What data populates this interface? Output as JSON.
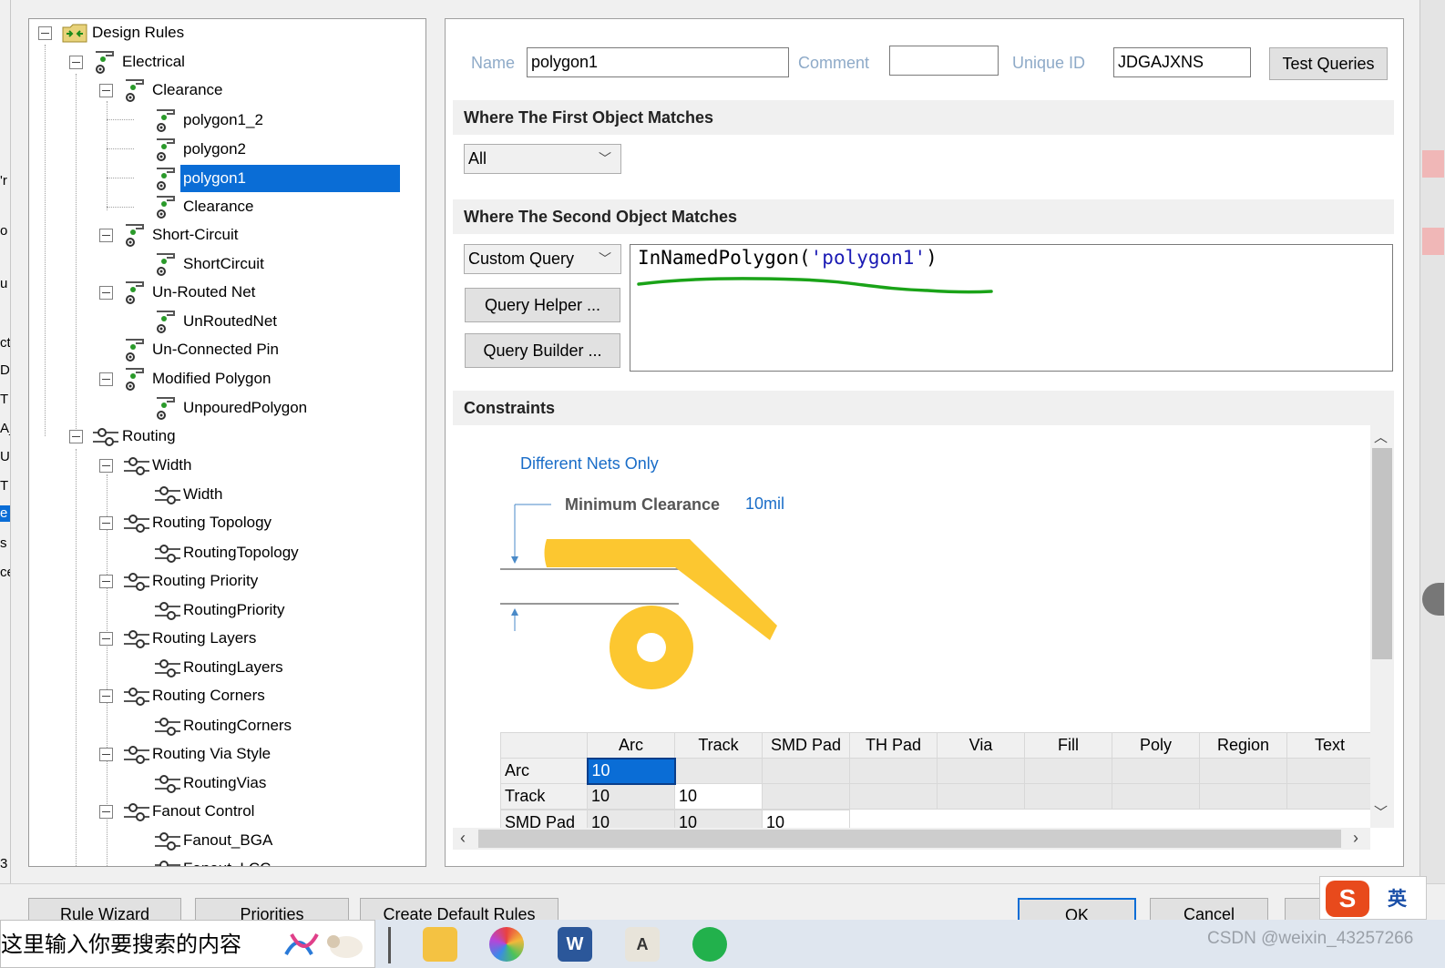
{
  "tree": {
    "root": "Design Rules",
    "electrical": "Electrical",
    "clearance": "Clearance",
    "polygon1_2": "polygon1_2",
    "polygon2": "polygon2",
    "polygon1": "polygon1",
    "clearance_rule": "Clearance",
    "short_circuit": "Short-Circuit",
    "short_circuit_rule": "ShortCircuit",
    "unrouted_net": "Un-Routed Net",
    "unrouted_net_rule": "UnRoutedNet",
    "unconnected_pin": "Un-Connected Pin",
    "modified_polygon": "Modified Polygon",
    "unpoured_polygon": "UnpouredPolygon",
    "routing": "Routing",
    "width": "Width",
    "width_rule": "Width",
    "routing_topology": "Routing Topology",
    "routing_topology_rule": "RoutingTopology",
    "routing_priority": "Routing Priority",
    "routing_priority_rule": "RoutingPriority",
    "routing_layers": "Routing Layers",
    "routing_layers_rule": "RoutingLayers",
    "routing_corners": "Routing Corners",
    "routing_corners_rule": "RoutingCorners",
    "routing_via_style": "Routing Via Style",
    "routing_via_style_rule": "RoutingVias",
    "fanout_control": "Fanout Control",
    "fanout_bga": "Fanout_BGA",
    "fanout_lcc": "Fanout_LCC"
  },
  "rule": {
    "name_label": "Name",
    "name_value": "polygon1",
    "comment_label": "Comment",
    "comment_value": "",
    "uid_label": "Unique ID",
    "uid_value": "JDGAJXNS",
    "test_queries": "Test Queries"
  },
  "first_match": {
    "header": "Where The First Object Matches",
    "scope": "All"
  },
  "second_match": {
    "header": "Where The Second Object Matches",
    "scope": "Custom Query",
    "query_helper": "Query Helper ...",
    "query_builder": "Query Builder ...",
    "query_fn": "InNamedPolygon(",
    "query_arg": "'polygon1'",
    "query_close": ")"
  },
  "constraints": {
    "header": "Constraints",
    "different_nets": "Different Nets Only",
    "min_clearance_label": "Minimum Clearance",
    "min_clearance_value": "10mil",
    "columns": [
      "",
      "Arc",
      "Track",
      "SMD Pad",
      "TH Pad",
      "Via",
      "Fill",
      "Poly",
      "Region",
      "Text"
    ],
    "rows": [
      {
        "label": "Arc",
        "values": [
          "10"
        ]
      },
      {
        "label": "Track",
        "values": [
          "10",
          "10"
        ]
      },
      {
        "label": "SMD Pad",
        "values": [
          "10",
          "10",
          "10"
        ]
      }
    ]
  },
  "buttons": {
    "rule_wizard": "Rule Wizard",
    "priorities": "Priorities",
    "create_default_rules": "Create Default Rules",
    "ok": "OK",
    "cancel": "Cancel"
  },
  "taskbar": {
    "search_placeholder": "这里输入你要搜索的内容",
    "watermark": "CSDN @weixin_43257266"
  },
  "ime": {
    "lang": "英"
  },
  "left_strip": [
    "'r",
    "o",
    "u",
    "ct",
    "D",
    "T",
    "A_",
    "U",
    "T",
    "e",
    "s",
    "ce",
    "3"
  ],
  "colors": {
    "selection": "#0a6dd6",
    "copper": "#fcc730",
    "annotation_green": "#1aa318",
    "blue_label": "#1a6dc8"
  }
}
